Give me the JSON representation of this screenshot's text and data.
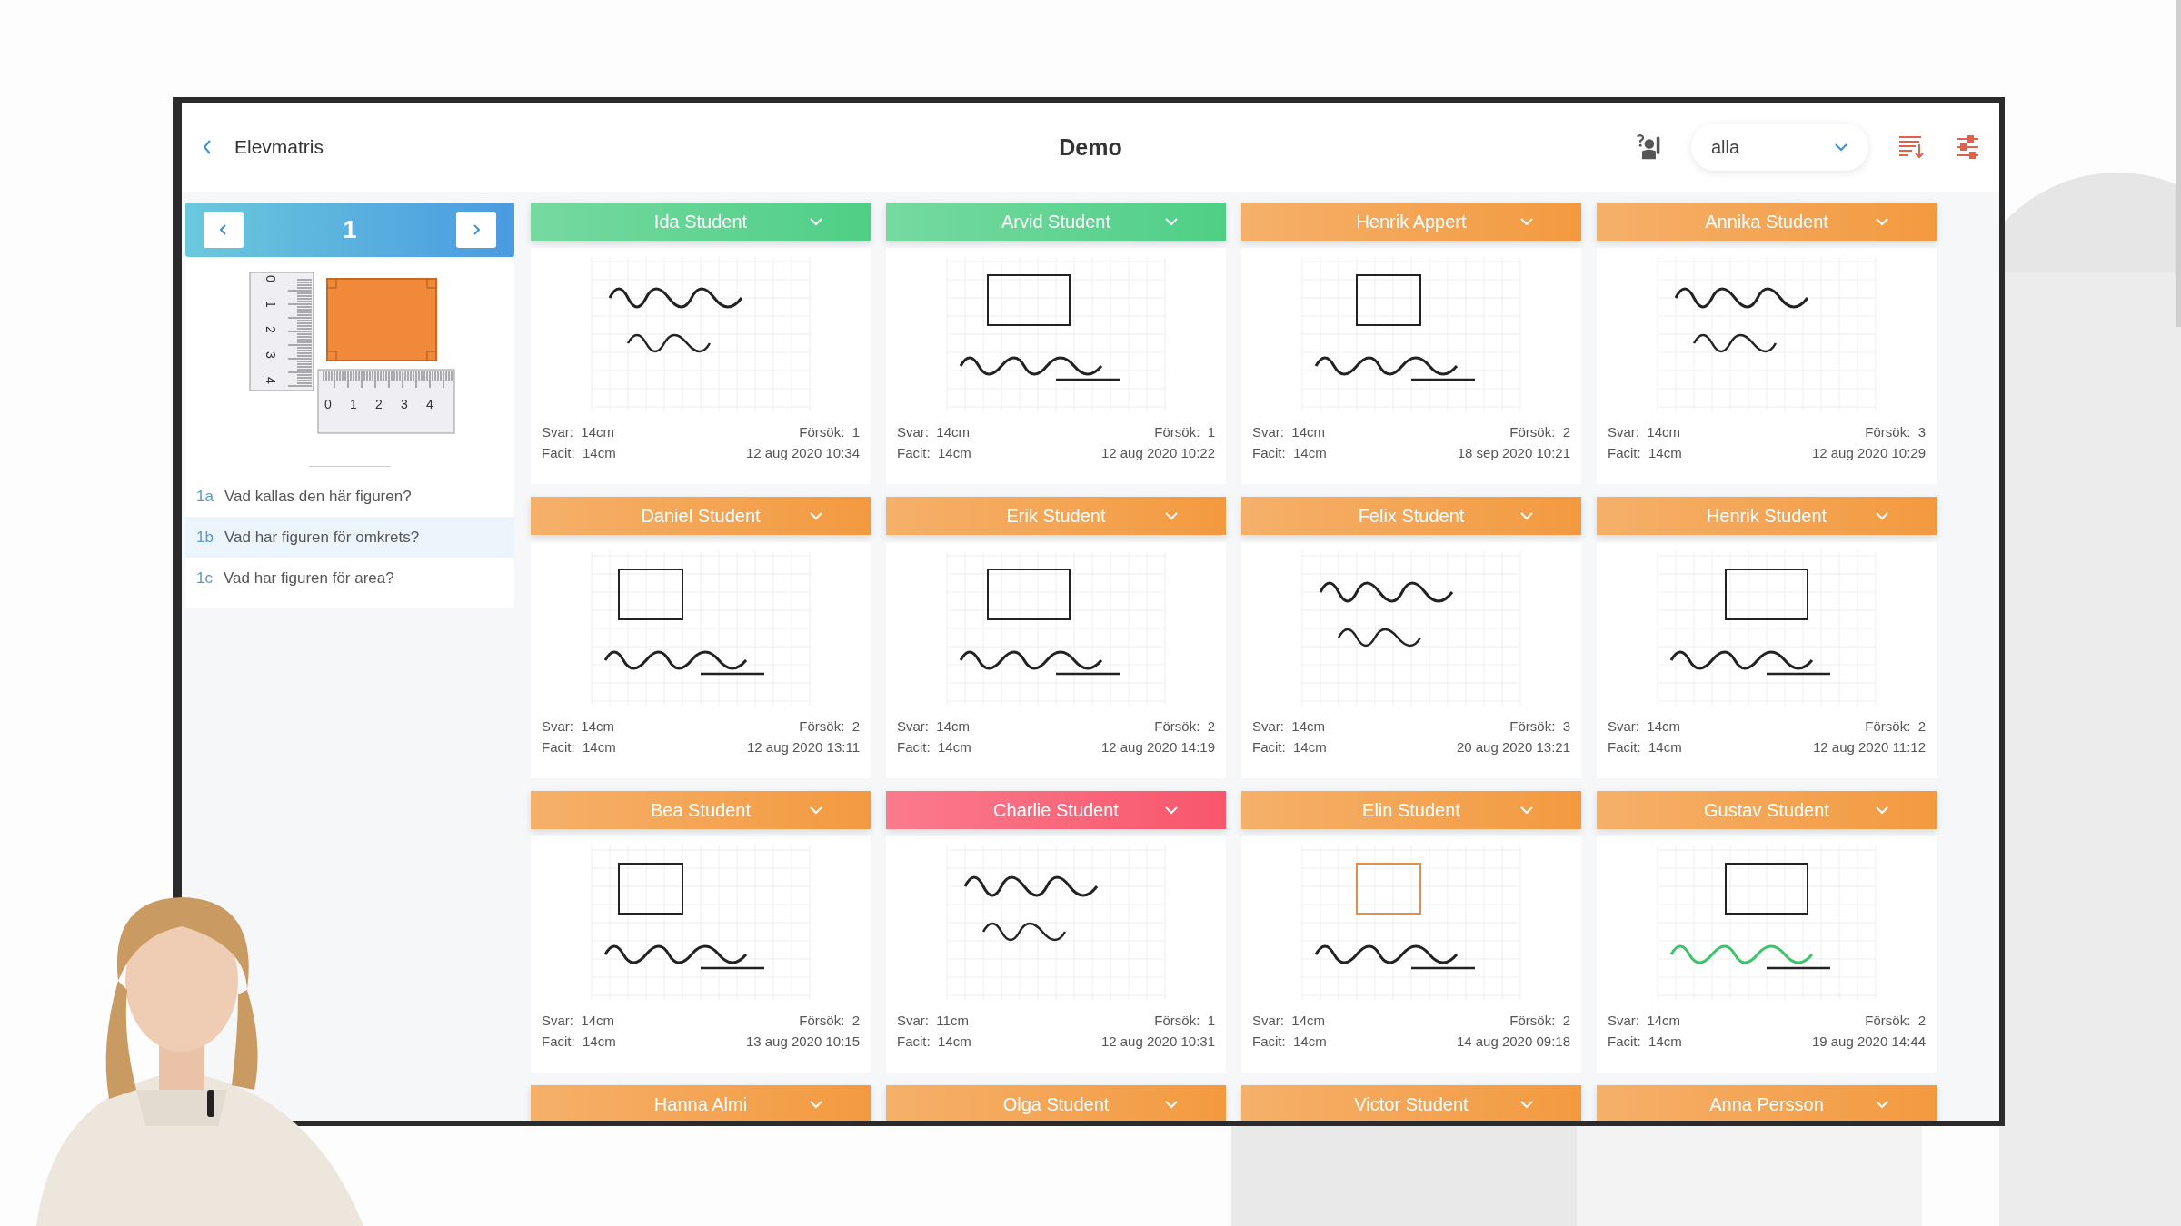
{
  "header": {
    "back_label": "Elevmatris",
    "title": "Demo",
    "filter": {
      "value": "alla"
    }
  },
  "task_nav": {
    "page": "1"
  },
  "figure": {
    "vertical_ruler": [
      "0",
      "1",
      "2",
      "3",
      "4"
    ],
    "horizontal_ruler": [
      "0",
      "1",
      "2",
      "3",
      "4"
    ]
  },
  "questions": [
    {
      "number": "1a",
      "text": "Vad kallas den här figuren?",
      "selected": false
    },
    {
      "number": "1b",
      "text": "Vad har figuren för omkrets?",
      "selected": true
    },
    {
      "number": "1c",
      "text": "Vad har figuren för area?",
      "selected": false
    }
  ],
  "students": [
    {
      "name": "Ida Student",
      "color": "#4fcf86",
      "answer": {
        "label": "Svar:",
        "value": "14cm"
      },
      "key": {
        "label": "Facit:",
        "value": "14cm"
      },
      "attempts": {
        "label": "Försök:",
        "value": "1"
      },
      "date": "12 aug 2020 10:34"
    },
    {
      "name": "Arvid Student",
      "color": "#4fcf86",
      "answer": {
        "label": "Svar:",
        "value": "14cm"
      },
      "key": {
        "label": "Facit:",
        "value": "14cm"
      },
      "attempts": {
        "label": "Försök:",
        "value": "1"
      },
      "date": "12 aug 2020 10:22"
    },
    {
      "name": "Henrik Appert",
      "color": "#f39a40",
      "answer": {
        "label": "Svar:",
        "value": "14cm"
      },
      "key": {
        "label": "Facit:",
        "value": "14cm"
      },
      "attempts": {
        "label": "Försök:",
        "value": "2"
      },
      "date": "18 sep 2020 10:21"
    },
    {
      "name": "Annika Student",
      "color": "#f39a40",
      "answer": {
        "label": "Svar:",
        "value": "14cm"
      },
      "key": {
        "label": "Facit:",
        "value": "14cm"
      },
      "attempts": {
        "label": "Försök:",
        "value": "3"
      },
      "date": "12 aug 2020 10:29"
    },
    {
      "name": "Daniel Student",
      "color": "#f39a40",
      "answer": {
        "label": "Svar:",
        "value": "14cm"
      },
      "key": {
        "label": "Facit:",
        "value": "14cm"
      },
      "attempts": {
        "label": "Försök:",
        "value": "2"
      },
      "date": "12 aug 2020 13:11"
    },
    {
      "name": "Erik Student",
      "color": "#f39a40",
      "answer": {
        "label": "Svar:",
        "value": "14cm"
      },
      "key": {
        "label": "Facit:",
        "value": "14cm"
      },
      "attempts": {
        "label": "Försök:",
        "value": "2"
      },
      "date": "12 aug 2020 14:19"
    },
    {
      "name": "Felix Student",
      "color": "#f39a40",
      "answer": {
        "label": "Svar:",
        "value": "14cm"
      },
      "key": {
        "label": "Facit:",
        "value": "14cm"
      },
      "attempts": {
        "label": "Försök:",
        "value": "3"
      },
      "date": "20 aug 2020 13:21"
    },
    {
      "name": "Henrik Student",
      "color": "#f39a40",
      "answer": {
        "label": "Svar:",
        "value": "14cm"
      },
      "key": {
        "label": "Facit:",
        "value": "14cm"
      },
      "attempts": {
        "label": "Försök:",
        "value": "2"
      },
      "date": "12 aug 2020 11:12"
    },
    {
      "name": "Bea Student",
      "color": "#f39a40",
      "answer": {
        "label": "Svar:",
        "value": "14cm"
      },
      "key": {
        "label": "Facit:",
        "value": "14cm"
      },
      "attempts": {
        "label": "Försök:",
        "value": "2"
      },
      "date": "13 aug 2020 10:15"
    },
    {
      "name": "Charlie Student",
      "color": "#f9566c",
      "answer": {
        "label": "Svar:",
        "value": "11cm"
      },
      "key": {
        "label": "Facit:",
        "value": "14cm"
      },
      "attempts": {
        "label": "Försök:",
        "value": "1"
      },
      "date": "12 aug 2020 10:31"
    },
    {
      "name": "Elin Student",
      "color": "#f39a40",
      "answer": {
        "label": "Svar:",
        "value": "14cm"
      },
      "key": {
        "label": "Facit:",
        "value": "14cm"
      },
      "attempts": {
        "label": "Försök:",
        "value": "2"
      },
      "date": "14 aug 2020 09:18"
    },
    {
      "name": "Gustav Student",
      "color": "#f39a40",
      "answer": {
        "label": "Svar:",
        "value": "14cm"
      },
      "key": {
        "label": "Facit:",
        "value": "14cm"
      },
      "attempts": {
        "label": "Försök:",
        "value": "2"
      },
      "date": "19 aug 2020 14:44"
    },
    {
      "name": "Hanna Almi",
      "color": "#f39a40"
    },
    {
      "name": "Olga Student",
      "color": "#f39a40"
    },
    {
      "name": "Victor Student",
      "color": "#f39a40"
    },
    {
      "name": "Anna Persson",
      "color": "#f39a40"
    }
  ]
}
